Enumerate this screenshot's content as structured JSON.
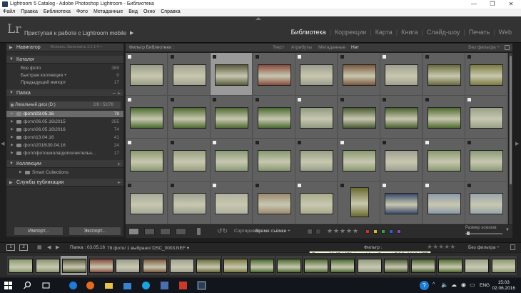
{
  "window": {
    "title": "Lightroom 5 Catalog - Adobe Photoshop Lightroom - Библиотека",
    "controls": [
      "—",
      "❐",
      "✕"
    ]
  },
  "menu": [
    "Файл",
    "Правка",
    "Библиотека",
    "Фото",
    "Метаданные",
    "Вид",
    "Окно",
    "Справка"
  ],
  "identity": {
    "logo": "Lr",
    "mobile_text": "Приступая к работе с Lightroom mobile",
    "mobile_arrow": "▶"
  },
  "modules": [
    {
      "label": "Библиотека",
      "active": true
    },
    {
      "label": "Коррекции",
      "active": false
    },
    {
      "label": "Карта",
      "active": false
    },
    {
      "label": "Книга",
      "active": false
    },
    {
      "label": "Слайд-шоу",
      "active": false
    },
    {
      "label": "Печать",
      "active": false
    },
    {
      "label": "Web",
      "active": false
    }
  ],
  "left_panel": {
    "navigator": {
      "label": "Навигатор",
      "options": "Вписать   Заполнить   1:1   1:4 ÷"
    },
    "catalog": {
      "label": "Каталог",
      "items": [
        {
          "label": "Все фото",
          "count": "389"
        },
        {
          "label": "Быстрая коллекция +",
          "count": "0"
        },
        {
          "label": "Предыдущий импорт",
          "count": "17"
        }
      ]
    },
    "folders": {
      "label": "Папка",
      "actions": "− +",
      "disk": {
        "label": "Локальный диск (D:)",
        "info": "2/8 / 52/78"
      },
      "items": [
        {
          "label": "фото\\03.05.16",
          "count": "78",
          "selected": true
        },
        {
          "label": "фото\\06.05.16\\2015",
          "count": "355",
          "selected": false
        },
        {
          "label": "фото\\06.05.16\\2016",
          "count": "74",
          "selected": false
        },
        {
          "label": "фото\\13.04.16",
          "count": "41",
          "selected": false
        },
        {
          "label": "фото\\2016\\30.04.16",
          "count": "24",
          "selected": false
        },
        {
          "label": "фото\\фотошкола\\дополнительн...",
          "count": "17",
          "selected": false
        }
      ]
    },
    "collections": {
      "label": "Коллекции",
      "action": "+",
      "items": [
        {
          "label": "Smart Collections"
        }
      ]
    },
    "publish": {
      "label": "Службы публикации",
      "action": "+"
    },
    "import_label": "Импорт...",
    "export_label": "Экспорт..."
  },
  "filter_bar": {
    "title": "Фильтр Библиотеки :",
    "tabs": [
      {
        "label": "Текст",
        "active": false
      },
      {
        "label": "Атрибуты",
        "active": false
      },
      {
        "label": "Метаданные",
        "active": false
      },
      {
        "label": "Нет",
        "active": true
      }
    ],
    "preset": "Без фильтра ÷"
  },
  "grid": {
    "cells": [
      {
        "badge": "w",
        "tone": "#9a9c86"
      },
      {
        "badge": "b",
        "tone": "#a2a290"
      },
      {
        "badge": "b",
        "tone": "#5a5c3e",
        "selected": true
      },
      {
        "badge": "b",
        "tone": "#8a4c3e"
      },
      {
        "badge": "w",
        "tone": "#9c9c8e"
      },
      {
        "badge": "b",
        "tone": "#7a5a3e"
      },
      {
        "badge": "w",
        "tone": "#a0a090"
      },
      {
        "badge": "b",
        "tone": "#6a6a3e"
      },
      {
        "badge": "b",
        "tone": "#7a7a3e"
      },
      {
        "badge": "w",
        "tone": "#4a6a2e"
      },
      {
        "badge": "b",
        "tone": "#4e6a30"
      },
      {
        "badge": "b",
        "tone": "#506a34"
      },
      {
        "badge": "b",
        "tone": "#4a6a30"
      },
      {
        "badge": "w",
        "tone": "#909a80"
      },
      {
        "badge": "b",
        "tone": "#4a5a34"
      },
      {
        "badge": "b",
        "tone": "#4a6030"
      },
      {
        "badge": "b",
        "tone": "#506a30"
      },
      {
        "badge": "w",
        "tone": "#98a088"
      },
      {
        "badge": "w",
        "tone": "#8a9a70"
      },
      {
        "badge": "b",
        "tone": "#9aa080"
      },
      {
        "badge": "w",
        "tone": "#8a9a78"
      },
      {
        "badge": "b",
        "tone": "#869870"
      },
      {
        "badge": "b",
        "tone": "#98a088"
      },
      {
        "badge": "w",
        "tone": "#8a9a70"
      },
      {
        "badge": "b",
        "tone": "#9ea090"
      },
      {
        "badge": "w",
        "tone": "#889a70"
      },
      {
        "badge": "b",
        "tone": "#8a9a78"
      },
      {
        "badge": "b",
        "tone": "#a6a898"
      },
      {
        "badge": "b",
        "tone": "#a0a292"
      },
      {
        "badge": "w",
        "tone": "#b0b0a0"
      },
      {
        "badge": "b",
        "tone": "#9c8a70"
      },
      {
        "badge": "w",
        "tone": "#a8aa8a"
      },
      {
        "badge": "b",
        "tone": "#6a6a30",
        "portrait": true
      },
      {
        "badge": "w",
        "tone": "#3a4a6a"
      },
      {
        "badge": "w",
        "tone": "#8a9aaa"
      },
      {
        "badge": "b",
        "tone": "#9aa4aa"
      }
    ]
  },
  "toolbar": {
    "sort_label": "Сортировка :",
    "sort_value": "Время съёмки ÷",
    "thumb_size_label": "Размер эскизов",
    "label_colors": [
      "#d03030",
      "#d0c030",
      "#40a040",
      "#3060d0",
      "#9040c0"
    ]
  },
  "secondary": {
    "monitors": [
      "1",
      "2"
    ],
    "path": "Папка : 03.05.16",
    "count": "78 фото/ 1 выбрано/ DSC_0003.NEF ▾",
    "filter_label": "Фильтр :",
    "filter_value": "Без фильтра ÷",
    "tooltip": "Папка : 03.05.1678 фото / 1 выбрано / DSC_0010.NEF"
  },
  "filmstrip": [
    {
      "tone": "#8a9a70"
    },
    {
      "tone": "#8a9670"
    },
    {
      "tone": "#5a5c3e",
      "selected": true
    },
    {
      "tone": "#8a4c3e"
    },
    {
      "tone": "#9c9c8e"
    },
    {
      "tone": "#7a5a3e"
    },
    {
      "tone": "#a0a090"
    },
    {
      "tone": "#6a6a3e"
    },
    {
      "tone": "#7a7a3e"
    },
    {
      "tone": "#4a6a2e"
    },
    {
      "tone": "#4e6a30"
    },
    {
      "tone": "#506a34"
    },
    {
      "tone": "#4a6a30"
    },
    {
      "tone": "#909a80"
    },
    {
      "tone": "#4a5a34"
    },
    {
      "tone": "#4a6030"
    },
    {
      "tone": "#506a30"
    },
    {
      "tone": "#98a088"
    },
    {
      "tone": "#8a9a70"
    }
  ],
  "taskbar": {
    "time": "15:03",
    "date": "02.06.2016",
    "lang": "ENG"
  }
}
